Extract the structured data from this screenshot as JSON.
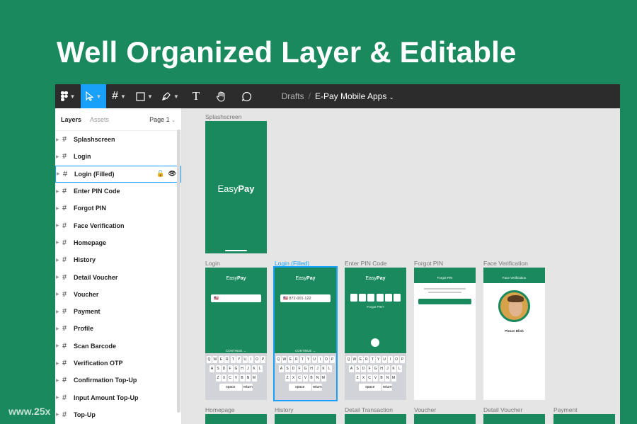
{
  "headline": "Well Organized Layer & Editable",
  "watermark": "www.25x",
  "toolbar": {
    "tools": [
      "main-menu",
      "move",
      "frame",
      "shape",
      "pen",
      "text",
      "hand",
      "comment"
    ],
    "text_tool_glyph": "T",
    "breadcrumb_drafts": "Drafts",
    "breadcrumb_sep": "/",
    "project_name": "E-Pay Mobile Apps",
    "accent": "#18a0fb"
  },
  "panel": {
    "tab_layers": "Layers",
    "tab_assets": "Assets",
    "page_selector": "Page 1"
  },
  "layers": [
    "Splashscreen",
    "Login",
    "Login (Filled)",
    "Enter PIN Code",
    "Forgot PIN",
    "Face Verification",
    "Homepage",
    "History",
    "Detail Voucher",
    "Voucher",
    "Payment",
    "Profile",
    "Scan Barcode",
    "Verification OTP",
    "Confirmation Top-Up",
    "Input Amount Top-Up",
    "Top-Up"
  ],
  "selected_layer": "Login (Filled)",
  "frames": {
    "splash": "Splashscreen",
    "login": "Login",
    "login_filled": "Login (Filled)",
    "pin": "Enter PIN Code",
    "forgot": "Forgot PIN",
    "face": "Face Verification",
    "homepage": "Homepage",
    "history": "History",
    "detail_transaction": "Detail Transaction",
    "voucher": "Voucher",
    "detail_voucher": "Detail Voucher",
    "payment": "Payment"
  },
  "app": {
    "logo_easy": "Easy",
    "logo_pay": "Pay",
    "phone_filled": "872-001-122",
    "continue": "CONTINUE →",
    "forgot_pin": "Forgot PIN?",
    "forgot_title": "Forgot PIN",
    "face_title": "Face Verification",
    "please_blink": "Please Blink",
    "space": "space",
    "return": "return"
  },
  "keyboard": {
    "row1": [
      "Q",
      "W",
      "E",
      "R",
      "T",
      "Y",
      "U",
      "I",
      "O",
      "P"
    ],
    "row2": [
      "A",
      "S",
      "D",
      "F",
      "G",
      "H",
      "J",
      "K",
      "L"
    ],
    "row3": [
      "Z",
      "X",
      "C",
      "V",
      "B",
      "N",
      "M"
    ]
  },
  "colors": {
    "brand_green": "#1a8a5e",
    "toolbar_bg": "#2c2c2c",
    "canvas_bg": "#e5e5e5"
  }
}
